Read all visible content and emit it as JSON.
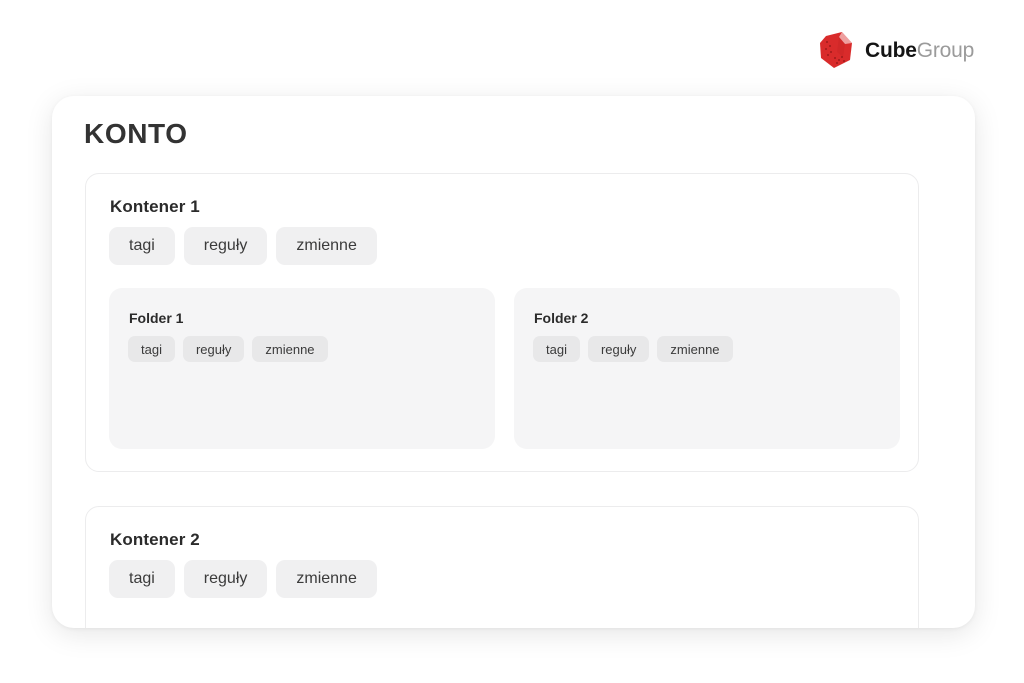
{
  "brand": {
    "logo_icon": "cube-logo-icon",
    "name": "Cube",
    "suffix": "Group",
    "mark_color": "#d92b2b",
    "name_color": "#141414",
    "suffix_color": "#9b9b9b"
  },
  "page": {
    "title": "KONTO",
    "background": "#ffffff"
  },
  "containers": [
    {
      "title": "Kontener 1",
      "tags": [
        "tagi",
        "reguły",
        "zmienne"
      ],
      "folders": [
        {
          "title": "Folder 1",
          "tags": [
            "tagi",
            "reguły",
            "zmienne"
          ]
        },
        {
          "title": "Folder 2",
          "tags": [
            "tagi",
            "reguły",
            "zmienne"
          ]
        }
      ]
    },
    {
      "title": "Kontener 2",
      "tags": [
        "tagi",
        "reguły",
        "zmienne"
      ],
      "folders": []
    }
  ]
}
